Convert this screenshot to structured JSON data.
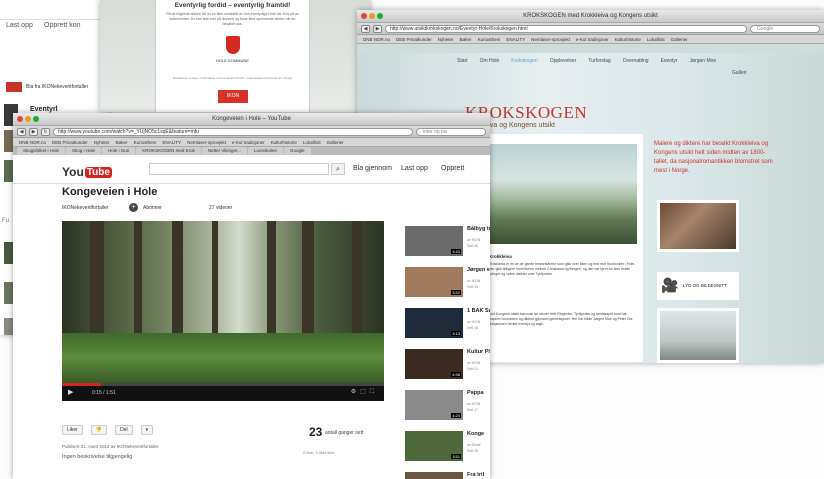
{
  "back_left": {
    "upload": "Last opp",
    "create": "Opprett kon",
    "channel": "Bla fra IKONekeventfortaller",
    "title": "Eventyrl",
    "fu": "Fu"
  },
  "doc_window": {
    "title": "Eventyrlig fordid – eventyrlig framtid!",
    "paragraph": "På de folgende sidene får du en liten smakebit av hva eventyrlige Hole har å by på av kulturminner. Du kan lese mer på ikonene og finne flere spennende steder når du besøker oss.",
    "kommune": "HOLE KOMMUNE",
    "footer": "Nettsidene er laget i forbindelse med prosjektet IKON – Interessante Kulturminner i Norge",
    "ikon": "IKON"
  },
  "krok_window": {
    "title": "KROKSKOGEN med Krokkleiva og Kongens utsikt",
    "url": "http://www.utsiktkrokskogen.no/Eventyr-Hole/Krokskogen.html",
    "search_placeholder": "Google",
    "bookmarks": [
      "DNB NOR.no",
      "DEB Privatkunder",
      "Nyheter",
      "Bøker",
      "Kuriosthem",
      "ENALITY",
      "Nemlaser-sprosjekt",
      "e-Kul tradisjoner",
      "Kulturhistorie",
      "Lokalhist",
      "Gallerier"
    ],
    "nav": [
      "Start",
      "Om Hole",
      "Krokskogen",
      "Opplevelser",
      "Turforslag",
      "Overnatting",
      "Eventyr",
      "Jørgen Moe"
    ],
    "nav_active_index": 2,
    "galleri": "Galleri",
    "heading": "KROKSKOGEN",
    "subheading": "Krokkleiva og Kongens utsikt",
    "section_head": "Krokkleiva",
    "para1": "Krokkleiva er en av de gamle ferdselsårene som gikk over åsen og ned mot Sundvollen i Hole. Her gikk tidligere hovedveien mellom Christiania og Bergen, og den var kjent for sine bratte svinger og vakre utsikter over Tyrifjorden.",
    "para2": "Ved Kongens utsikt kan man se utover hele Ringerike, Tyrifjorden og landskapet som har inspirert kunstnere og diktere gjennom generasjoner. Her har både Jørgen Moe og Peter Chr. Asbjørnsen hentet eventyr og sagn.",
    "red_text": "Malere og diktere har besøkt Krokkleiva og Kongens utsikt helt siden midten av 1800-tallet, da nasjonalromantikken blomstret som mest i Norge.",
    "video_label": "LYD OG BILDESNITT"
  },
  "yt_window": {
    "title": "Kongeveien i Hole – YouTube",
    "url": "http://www.youtube.com/watch?v=_YUjNO5c1xqE&feature=mfu",
    "search_placeholder": "inter og pa",
    "bookmarks": [
      "DNB NOR.no",
      "DEB Privatkunder",
      "Nyheter",
      "Bøker",
      "Kuriosthem",
      "ENALITY",
      "Nemlaser-sprosjekt",
      "e-Kul tradisjoner",
      "Kulturhistorie",
      "Lokalhist",
      "Gallerier"
    ],
    "tabs": [
      "Skogsfolket i Hole",
      "Skog i Hole",
      "Hole i Guri",
      "KROKSKOGEN med Krok",
      "Netter Vikinger...",
      "Lunnskolen",
      "Google"
    ],
    "logo_you": "You",
    "logo_tube": "Tube",
    "browse": "Bla gjennom",
    "upload": "Last opp",
    "create": "Opprett",
    "video_title": "Kongeveien i Hole",
    "channel": "IKONekeventfortaller",
    "subscribe": "Abonner",
    "video_count": "27 videoer",
    "time": "0:15 / 1:51",
    "progress": 0.12,
    "like": "Liker",
    "dislike": "",
    "share": "Del",
    "views": "23",
    "views_label": "antall ganger sett",
    "views2": "0 liker, 0 liker ikke",
    "posted": "Publisert 21. mars 2012 av IKONekeventfortaller",
    "no_desc": "Ingen beskrivelse tilgjengelig.",
    "related": [
      {
        "title": "Bålbyg tradisj",
        "sub": "av IKON",
        "sub2": "Sett 30",
        "dur": "3:43",
        "color": "#6b6b6b"
      },
      {
        "title": "Jørgen eventy",
        "sub": "av IKON",
        "sub2": "Sett 30",
        "dur": "3:52",
        "color": "#a07a5c"
      },
      {
        "title": "1 BAK Smått",
        "sub": "av IKON",
        "sub2": "Sett 16",
        "dur": "3:13",
        "color": "#1e2a3a"
      },
      {
        "title": "Kultur Plasse",
        "sub": "av IKON",
        "sub2": "Sett 21",
        "dur": "4:58",
        "color": "#3a2a20"
      },
      {
        "title": "Pappa",
        "sub": "av IKON",
        "sub2": "Sett 17",
        "dur": "4:24",
        "color": "#8a8a8a"
      },
      {
        "title": "Konge",
        "sub": "av Ekdal",
        "sub2": "Sett 15",
        "dur": "3:51",
        "color": "#4f6a3a"
      },
      {
        "title": "Fra tril",
        "sub": "",
        "sub2": "",
        "dur": "",
        "color": "#6a5540"
      }
    ]
  }
}
